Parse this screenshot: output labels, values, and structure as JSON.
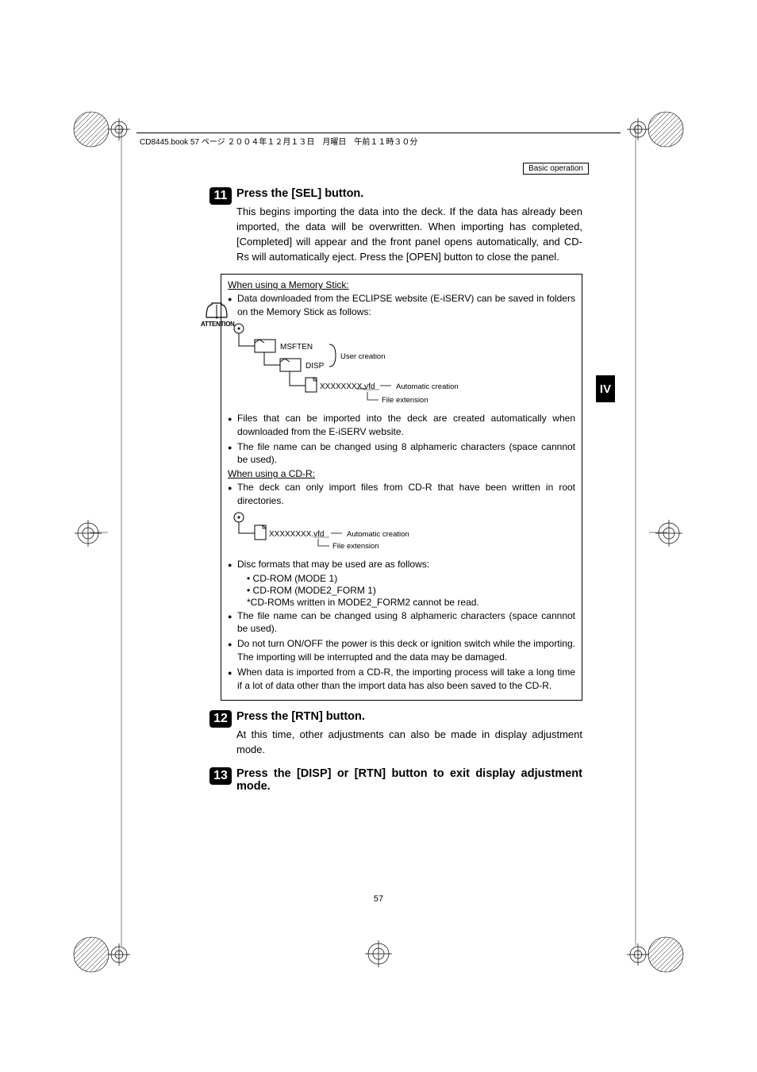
{
  "header": {
    "line": "CD8445.book  57 ページ  ２００４年１２月１３日　月曜日　午前１１時３０分"
  },
  "topbox": "Basic operation",
  "side_tab": "IV",
  "attention_label": "ATTENTION",
  "step11": {
    "num": "11",
    "title": "Press the [SEL] button.",
    "body": "This begins importing the data into the deck. If the data has already been imported, the data will be overwritten. When importing has completed, [Completed] will appear and   the front panel opens automatically, and CD-Rs will automatically eject. Press the [OPEN] button to close the panel."
  },
  "note": {
    "ms_title": "When using a Memory Stick:",
    "ms_b1": "Data downloaded from the ECLIPSE website (E-iSERV) can be saved in folders on the Memory Stick as follows:",
    "diag1": {
      "root": "MSFTEN",
      "sub": "DISP",
      "file": "XXXXXXXX.vfd",
      "lbl_user": "User creation",
      "lbl_auto": "Automatic creation",
      "lbl_ext": "File extension"
    },
    "ms_b2": "Files that can be imported into the deck are created automatically when downloaded from the E-iSERV website.",
    "ms_b3": "The file name can be changed using 8 alphameric characters (space cannnot be used).",
    "cd_title": "When using a CD-R:",
    "cd_b1": "The deck can only import files from CD-R that have been written in root directories.",
    "diag2": {
      "file": "XXXXXXXX.vfd",
      "lbl_auto": "Automatic creation",
      "lbl_ext": "File extension"
    },
    "cd_b2": "Disc formats that may be used are as follows:",
    "cd_sub1": "• CD-ROM (MODE 1)",
    "cd_sub2": "• CD-ROM (MODE2_FORM 1)",
    "cd_sub3": "*CD-ROMs written in MODE2_FORM2 cannot be read.",
    "cd_b3": "The file name can be changed using 8 alphameric characters (space cannnot be used).",
    "cd_b4": "Do not turn ON/OFF the power is this deck or ignition switch while the importing. The importing will be interrupted and the data may be damaged.",
    "cd_b5": "When data is imported from a CD-R, the importing process will take a long time if a lot of data other than the import data has also been saved to the CD-R."
  },
  "step12": {
    "num": "12",
    "title": "Press the [RTN] button.",
    "body": "At this time, other adjustments can also be made in display adjustment mode."
  },
  "step13": {
    "num": "13",
    "title": "Press the [DISP] or [RTN] button to exit display adjustment mode."
  },
  "page_number": "57"
}
